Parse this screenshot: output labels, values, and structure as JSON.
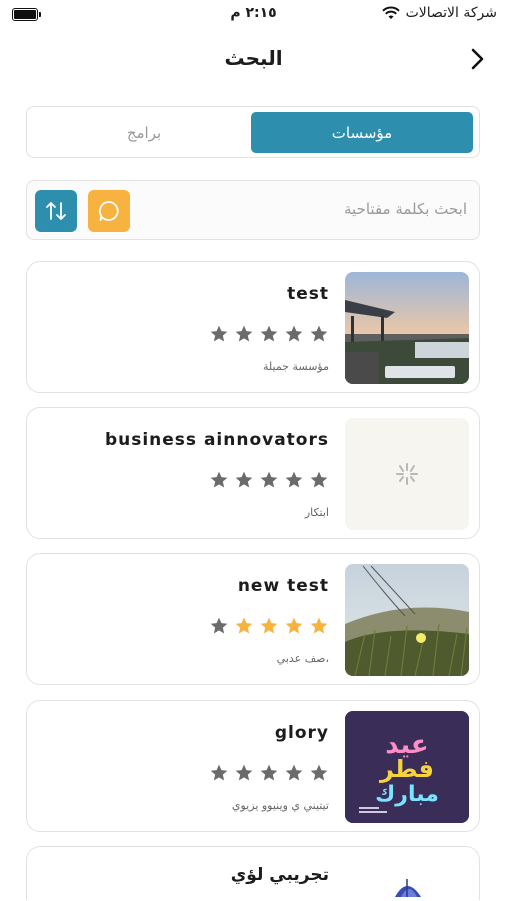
{
  "status_bar": {
    "carrier": "شركة الاتصالات",
    "time": "٢:١٥ م"
  },
  "header": {
    "title": "البحث"
  },
  "tabs": {
    "active": "مؤسسات",
    "inactive": "برامج"
  },
  "search": {
    "placeholder": "ابحث بكلمة مفتاحية"
  },
  "colors": {
    "accent": "#2d8fad",
    "secondary": "#f7b240",
    "star_active": "#f7b240",
    "star_inactive": "#6b6b6b"
  },
  "results": [
    {
      "name": "test",
      "category": "مؤسسة جميلة",
      "rating": 0,
      "image": "beach-sunset-photo"
    },
    {
      "name": "business ainnovators",
      "category": "ابتكار",
      "rating": 0,
      "image": "loading-spinner"
    },
    {
      "name": "new test",
      "category": "،صف عدبي",
      "rating": 4,
      "image": "grass-dune-photo"
    },
    {
      "name": "glory",
      "category": "تيتيني ي وينيوو يزيوي",
      "rating": 0,
      "image": "eid-fitr-mubarak-poster"
    },
    {
      "name": "تجريبي لؤي",
      "image": "logo-shell"
    }
  ]
}
